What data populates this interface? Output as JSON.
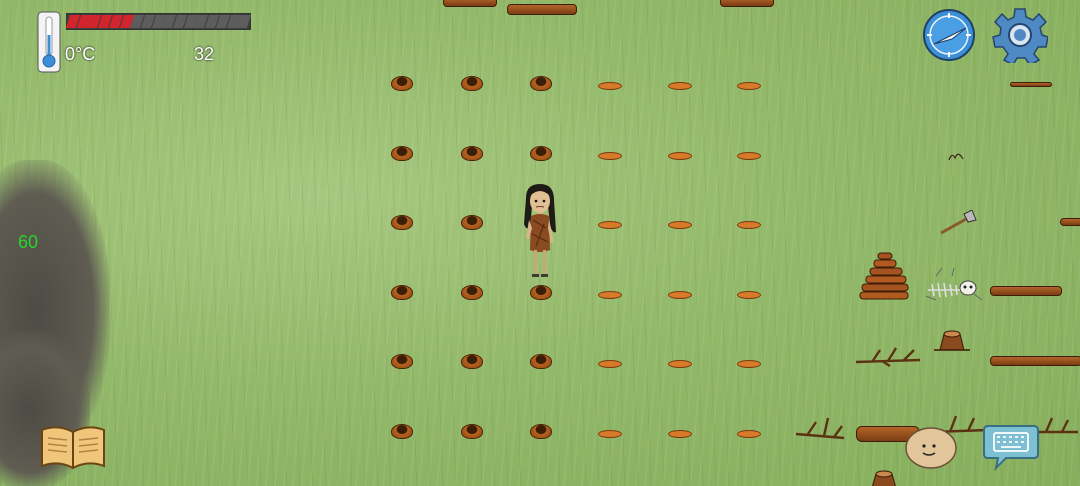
{
  "hud": {
    "temperature": "0°C",
    "age": "32",
    "fps": "60",
    "food_meter": {
      "filled": 6,
      "total": 17
    },
    "food_color": "#d2242c"
  },
  "controls": {
    "compass_icon": "compass-icon",
    "settings_icon": "gear-icon",
    "tech_tree_icon": "book-icon",
    "emote_icon": "smiley-face-icon",
    "keyboard_icon": "keyboard-icon"
  },
  "colors": {
    "grass": "#93b96a",
    "compass": "#3c8fd6",
    "settings": "#4f89c4",
    "keyboard": "#7dbfd3"
  }
}
